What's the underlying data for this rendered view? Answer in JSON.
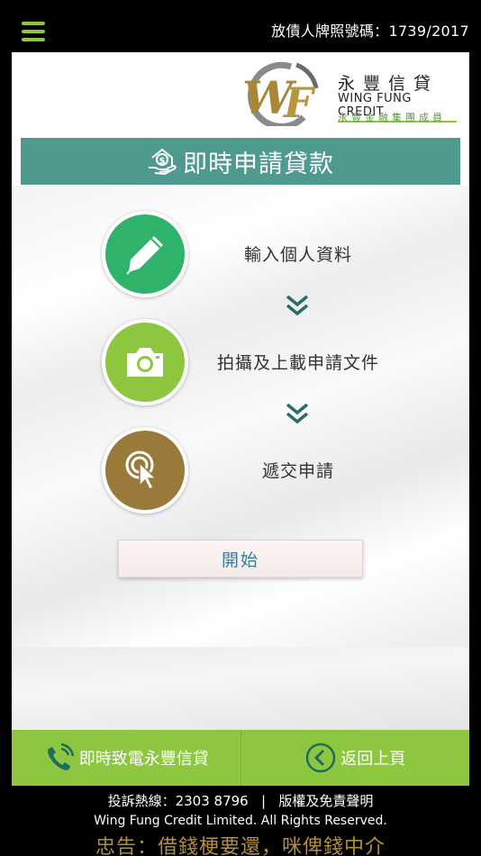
{
  "header": {
    "license_text": "放債人牌照號碼：1739/2017"
  },
  "logo": {
    "mark_letters": "WF",
    "name_zh": "永豐信貸",
    "name_en": "WING FUNG CREDIT",
    "subtitle_zh": "永豐金融集團成員"
  },
  "title": {
    "text": "即時申請貸款",
    "color": "#4e9a8e"
  },
  "steps": [
    {
      "label": "輸入個人資料",
      "icon": "pen-icon",
      "color": "#2fb36a"
    },
    {
      "label": "拍攝及上載申請文件",
      "icon": "camera-icon",
      "color": "#8dc63f"
    },
    {
      "label": "遞交申請",
      "icon": "click-icon",
      "color": "#9a7a3a"
    }
  ],
  "start_button": {
    "label": "開始"
  },
  "bottom_bar": {
    "call_label": "即時致電永豐信貸",
    "back_label": "返回上頁",
    "color": "#8dc63f"
  },
  "footer": {
    "hotline_label": "投訴熱線：2303 8796",
    "separator": "|",
    "disclaimer_label": "版權及免責聲明",
    "copyright": "Wing Fung Credit Limited. All Rights Reserved.",
    "warning": "忠告：借錢梗要還，咪俾錢中介",
    "warning_color": "#b28f3a"
  },
  "colors": {
    "accent_green": "#8dc63f",
    "teal": "#4e9a8e",
    "chevron": "#2a6b6b"
  }
}
